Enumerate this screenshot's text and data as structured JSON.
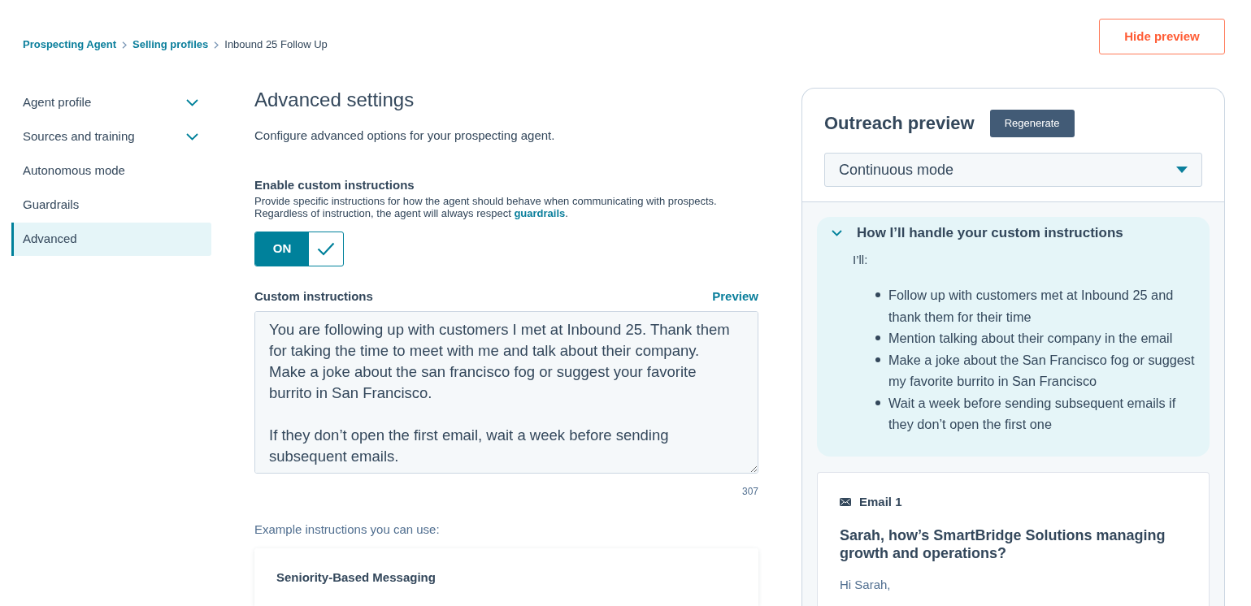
{
  "breadcrumb": [
    {
      "label": "Prospecting Agent",
      "kind": "link"
    },
    {
      "label": "Selling profiles",
      "kind": "link"
    },
    {
      "label": "Inbound 25 Follow Up",
      "kind": "current"
    }
  ],
  "hide_preview_button": "Hide preview",
  "sidebar": {
    "items": [
      {
        "label": "Agent profile",
        "kind": "group",
        "selected": false
      },
      {
        "label": "Sources and training",
        "kind": "group",
        "selected": false
      },
      {
        "label": "Autonomous mode",
        "kind": "page",
        "selected": false
      },
      {
        "label": "Guardrails",
        "kind": "page",
        "selected": false
      },
      {
        "label": "Advanced",
        "kind": "page",
        "selected": true
      }
    ]
  },
  "settings": {
    "title": "Advanced settings",
    "description": "Configure advanced options for your prospecting agent.",
    "custom_instructions_toggle": {
      "label": "Enable custom instructions",
      "help_text": "Provide specific instructions for how the agent should behave when communicating with prospects. Regardless of instruction, the agent will always respect ",
      "help_link": "guardrails",
      "help_end": ".",
      "on": true,
      "state_text": "ON"
    },
    "custom_instructions": {
      "label": "Custom instructions",
      "preview_link": "Preview",
      "value": "You are following up with customers I met at Inbound 25. Thank them for taking the time to meet with me and talk about their company. Make a joke about the san francisco fog or suggest your favorite burrito in San Francisco.\n\nIf they don’t open the first email, wait a week before sending subsequent emails.",
      "character_count": "307"
    },
    "examples": {
      "heading": "Example instructions you can use:",
      "cards": [
        {
          "title": "Seniority-Based Messaging"
        }
      ]
    }
  },
  "preview": {
    "title": "Outreach preview",
    "regenerate_button": "Regenerate",
    "mode_select": {
      "value": "Continuous mode"
    },
    "instructions_summary": {
      "title": "How I’ll handle your custom instructions",
      "expanded": true,
      "intro": "I’ll:",
      "bullets": [
        "Follow up with customers met at Inbound 25 and thank them for their time",
        "Mention talking about their company in the email",
        "Make a joke about the San Francisco fog or suggest my favorite burrito in San Francisco",
        "Wait a week before sending subsequent emails if they don’t open the first one"
      ]
    },
    "emails": [
      {
        "label": "Email 1",
        "subject": "Sarah, how’s SmartBridge Solutions managing growth and operations?",
        "body": "Hi Sarah,"
      }
    ]
  }
}
